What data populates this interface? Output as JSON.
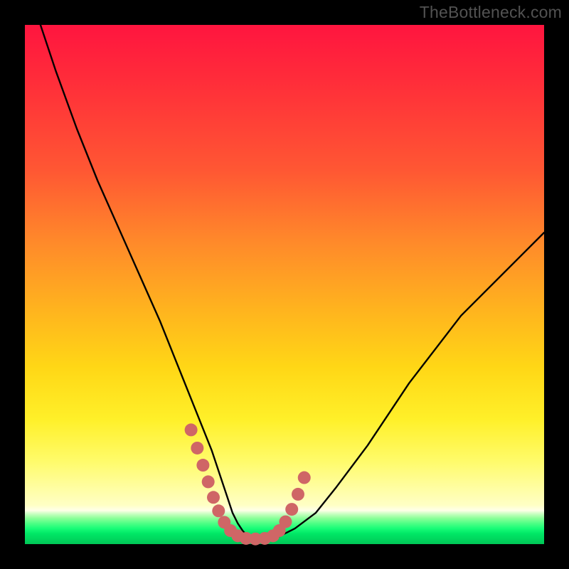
{
  "watermark": "TheBottleneck.com",
  "chart_data": {
    "type": "line",
    "title": "",
    "xlabel": "",
    "ylabel": "",
    "xlim": [
      0,
      100
    ],
    "ylim": [
      0,
      100
    ],
    "series": [
      {
        "name": "bottleneck-curve",
        "x": [
          3,
          6,
          10,
          14,
          18,
          22,
          26,
          28,
          30,
          32,
          34,
          36,
          37,
          38,
          39,
          40,
          41,
          42,
          43,
          45,
          47,
          49,
          52,
          56,
          60,
          66,
          74,
          84,
          96,
          100
        ],
        "y": [
          100,
          91,
          80,
          70,
          61,
          52,
          43,
          38,
          33,
          28,
          23,
          18,
          15,
          12,
          9,
          6,
          4,
          2.5,
          1.5,
          1,
          1,
          1.5,
          3,
          6,
          11,
          19,
          31,
          44,
          56,
          60
        ]
      }
    ],
    "overlay": {
      "name": "highlight-dots",
      "color": "#cf6666",
      "points": [
        {
          "x": 32.0,
          "y": 22.0
        },
        {
          "x": 33.2,
          "y": 18.5
        },
        {
          "x": 34.3,
          "y": 15.2
        },
        {
          "x": 35.3,
          "y": 12.0
        },
        {
          "x": 36.3,
          "y": 9.0
        },
        {
          "x": 37.3,
          "y": 6.4
        },
        {
          "x": 38.4,
          "y": 4.2
        },
        {
          "x": 39.6,
          "y": 2.6
        },
        {
          "x": 41.0,
          "y": 1.6
        },
        {
          "x": 42.6,
          "y": 1.1
        },
        {
          "x": 44.4,
          "y": 1.0
        },
        {
          "x": 46.2,
          "y": 1.1
        },
        {
          "x": 47.8,
          "y": 1.6
        },
        {
          "x": 49.0,
          "y": 2.6
        },
        {
          "x": 50.2,
          "y": 4.3
        },
        {
          "x": 51.4,
          "y": 6.7
        },
        {
          "x": 52.6,
          "y": 9.6
        },
        {
          "x": 53.8,
          "y": 12.8
        }
      ]
    },
    "gradient_stops": [
      {
        "pos": 0.0,
        "color": "#ff153f"
      },
      {
        "pos": 0.28,
        "color": "#ff5733"
      },
      {
        "pos": 0.55,
        "color": "#ffb41e"
      },
      {
        "pos": 0.76,
        "color": "#fff029"
      },
      {
        "pos": 0.93,
        "color": "#ffffe0"
      },
      {
        "pos": 1.0,
        "color": "#00c757"
      }
    ]
  }
}
